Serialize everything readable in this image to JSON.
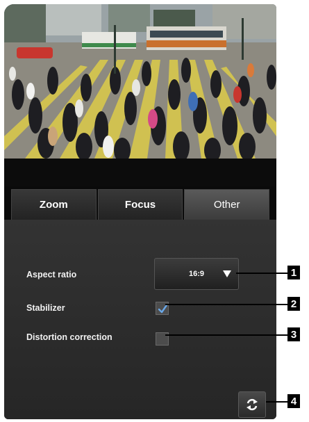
{
  "tabs": [
    {
      "label": "Zoom",
      "active": false
    },
    {
      "label": "Focus",
      "active": false
    },
    {
      "label": "Other",
      "active": true
    }
  ],
  "settings": {
    "aspect_ratio_label": "Aspect ratio",
    "aspect_ratio_value": "16:9",
    "stabilizer_label": "Stabilizer",
    "stabilizer_checked": true,
    "distortion_label": "Distortion correction",
    "distortion_checked": false
  },
  "callouts": [
    "1",
    "2",
    "3",
    "4"
  ],
  "icons": {
    "dropdown": "triangle-down-icon",
    "checkmark": "checkmark-icon",
    "refresh": "refresh-icon"
  },
  "colors": {
    "check_accent": "#6aa8e8",
    "panel": "#2e2e2e"
  }
}
